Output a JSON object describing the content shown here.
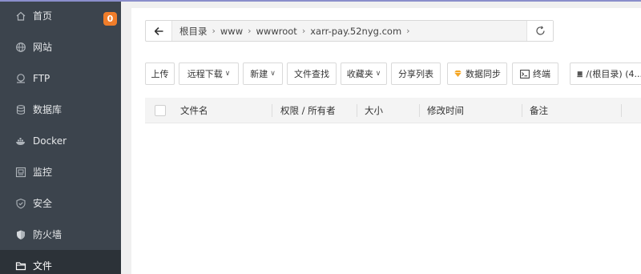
{
  "sidebar": {
    "items": [
      {
        "label": "首页",
        "icon": "home-icon"
      },
      {
        "label": "网站",
        "icon": "globe-icon"
      },
      {
        "label": "FTP",
        "icon": "ftp-icon"
      },
      {
        "label": "数据库",
        "icon": "database-icon"
      },
      {
        "label": "Docker",
        "icon": "docker-icon"
      },
      {
        "label": "监控",
        "icon": "monitor-icon"
      },
      {
        "label": "安全",
        "icon": "shield-icon"
      },
      {
        "label": "防火墙",
        "icon": "firewall-icon"
      },
      {
        "label": "文件",
        "icon": "folder-icon"
      }
    ],
    "home_badge": "0",
    "active_item": "文件"
  },
  "path": {
    "crumbs": [
      "根目录",
      "www",
      "wwwroot",
      "xarr-pay.52nyg.com"
    ]
  },
  "toolbar": {
    "upload": "上传",
    "remote_download": "远程下载",
    "new": "新建",
    "file_search": "文件查找",
    "favorites": "收藏夹",
    "share_list": "分享列表",
    "data_sync": "数据同步",
    "terminal": "终端",
    "disk": "/(根目录) (4..."
  },
  "table": {
    "columns": [
      "文件名",
      "权限 / 所有者",
      "大小",
      "修改时间",
      "备注"
    ]
  },
  "colors": {
    "sidebar_bg": "#3c444d",
    "sidebar_active": "#2c3238",
    "badge": "#f07d2a",
    "sync_icon": "#f5a623"
  }
}
